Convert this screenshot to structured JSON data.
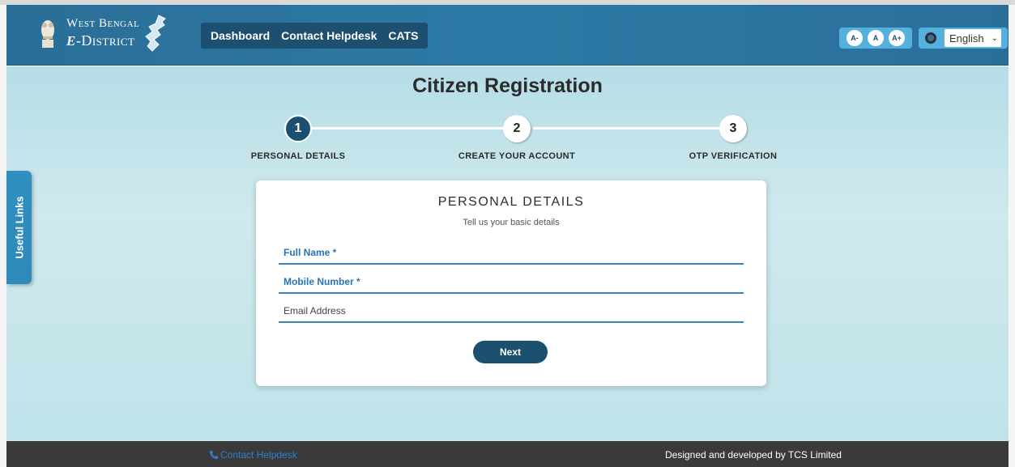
{
  "header": {
    "logo": {
      "line1": "West Bengal",
      "line2_prefix": "e",
      "line2_rest": "-District"
    },
    "nav": [
      {
        "label": "Dashboard"
      },
      {
        "label": "Contact Helpdesk"
      },
      {
        "label": "CATS"
      }
    ],
    "font_controls": {
      "decrease": "A-",
      "normal": "A",
      "increase": "A+"
    },
    "language": {
      "selected": "English",
      "icon": "globe-icon"
    }
  },
  "page": {
    "title": "Citizen Registration",
    "steps": [
      {
        "number": "1",
        "label": "PERSONAL DETAILS",
        "state": "active"
      },
      {
        "number": "2",
        "label": "CREATE YOUR ACCOUNT",
        "state": "pending"
      },
      {
        "number": "3",
        "label": "OTP VERIFICATION",
        "state": "pending"
      }
    ]
  },
  "form": {
    "title": "PERSONAL DETAILS",
    "subtitle": "Tell us your basic details",
    "fields": [
      {
        "label": "Full Name *",
        "value": ""
      },
      {
        "label": "Mobile Number *",
        "value": ""
      },
      {
        "label": "Email Address",
        "value": ""
      }
    ],
    "next_label": "Next"
  },
  "sidebar_tab": {
    "label": "Useful Links"
  },
  "footer": {
    "contact_label": "Contact Helpdesk",
    "credit": "Designed and developed by TCS Limited"
  },
  "colors": {
    "header": "#2d7aa6",
    "primary_dark": "#1c506f",
    "accent_blue": "#56b0de",
    "field_underline": "#3a86b9",
    "footer": "#3a3a3a"
  }
}
